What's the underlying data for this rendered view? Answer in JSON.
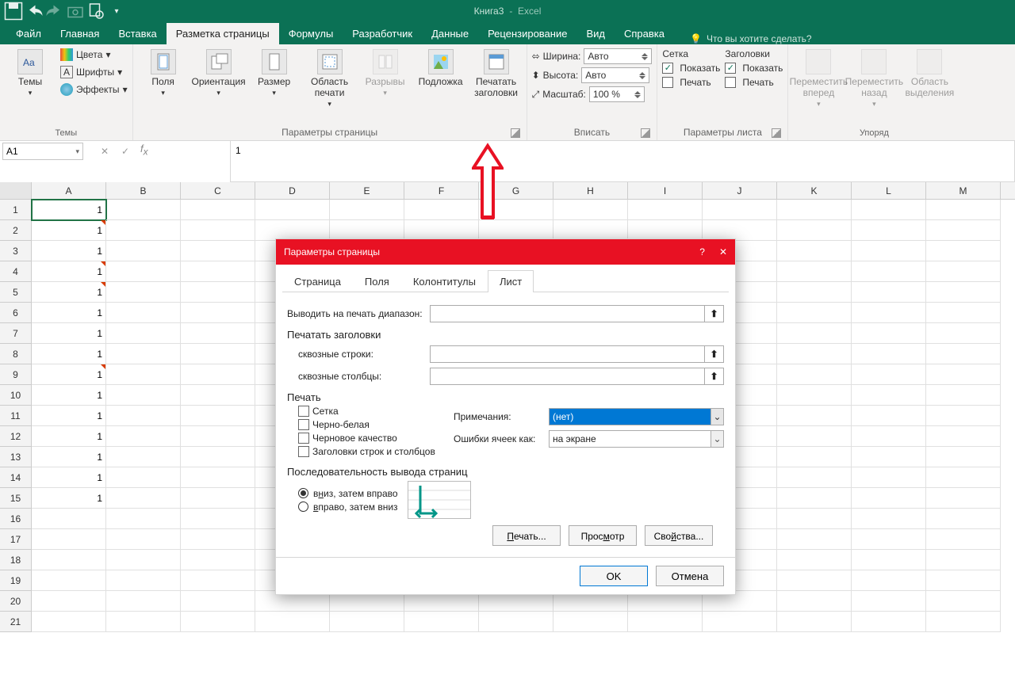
{
  "app": {
    "title_doc": "Книга3",
    "title_app": "Excel"
  },
  "qat": {
    "save": "save",
    "undo": "undo",
    "redo": "redo",
    "cam": "camera",
    "preview": "print-preview"
  },
  "tabs": {
    "file": "Файл",
    "home": "Главная",
    "insert": "Вставка",
    "pagelayout": "Разметка страницы",
    "formulas": "Формулы",
    "developer": "Разработчик",
    "data": "Данные",
    "review": "Рецензирование",
    "view": "Вид",
    "help": "Справка",
    "tellme": "Что вы хотите сделать?"
  },
  "ribbon": {
    "themes": {
      "themes": "Темы",
      "colors": "Цвета",
      "fonts": "Шрифты",
      "effects": "Эффекты",
      "grp": "Темы"
    },
    "page": {
      "margins": "Поля",
      "orient": "Ориентация",
      "size": "Размер",
      "area": "Область печати",
      "breaks": "Разрывы",
      "bg": "Подложка",
      "titles": "Печатать заголовки",
      "grp": "Параметры страницы"
    },
    "fit": {
      "width_l": "Ширина:",
      "width_v": "Авто",
      "height_l": "Высота:",
      "height_v": "Авто",
      "scale_l": "Масштаб:",
      "scale_v": "100 %",
      "grp": "Вписать"
    },
    "sheet": {
      "grid": "Сетка",
      "headings": "Заголовки",
      "show": "Показать",
      "print": "Печать",
      "grp": "Параметры листа"
    },
    "arrange": {
      "fwd": "Переместить вперед",
      "back": "Переместить назад",
      "pane": "Область выделения",
      "grp": "Упоряд"
    }
  },
  "namebox": "A1",
  "formula": "1",
  "cols": [
    "A",
    "B",
    "C",
    "D",
    "E",
    "F",
    "G",
    "H",
    "I",
    "J",
    "K",
    "L",
    "M"
  ],
  "rows": [
    1,
    2,
    3,
    4,
    5,
    6,
    7,
    8,
    9,
    10,
    11,
    12,
    13,
    14,
    15,
    16,
    17,
    18,
    19,
    20,
    21
  ],
  "values": {
    "1": "1",
    "2": "1",
    "3": "1",
    "4": "1",
    "5": "1",
    "6": "1",
    "7": "1",
    "8": "1",
    "9": "1",
    "10": "1",
    "11": "1",
    "12": "1",
    "13": "1",
    "14": "1",
    "15": "1"
  },
  "redmarks": [
    2,
    4,
    5,
    9
  ],
  "dialog": {
    "title": "Параметры страницы",
    "help": "?",
    "close": "✕",
    "tabs": {
      "page": "Страница",
      "margins": "Поля",
      "hf": "Колонтитулы",
      "sheet": "Лист"
    },
    "print_range_l": "Выводить на печать диапазон:",
    "print_titles_hdr": "Печатать заголовки",
    "rows_repeat_l": "сквозные строки:",
    "cols_repeat_l": "сквозные столбцы:",
    "print_hdr": "Печать",
    "chk_grid": "Сетка",
    "chk_bw": "Черно-белая",
    "chk_draft": "Черновое качество",
    "chk_headings": "Заголовки строк и столбцов",
    "comments_l": "Примечания:",
    "comments_v": "(нет)",
    "errors_l": "Ошибки ячеек как:",
    "errors_v": "на экране",
    "order_hdr": "Последовательность вывода страниц",
    "order_down": "вниз, затем вправо",
    "order_over": "вправо, затем вниз",
    "btn_print": "Печать...",
    "btn_preview": "Просмотр",
    "btn_props": "Свойства...",
    "ok": "OK",
    "cancel": "Отмена"
  }
}
